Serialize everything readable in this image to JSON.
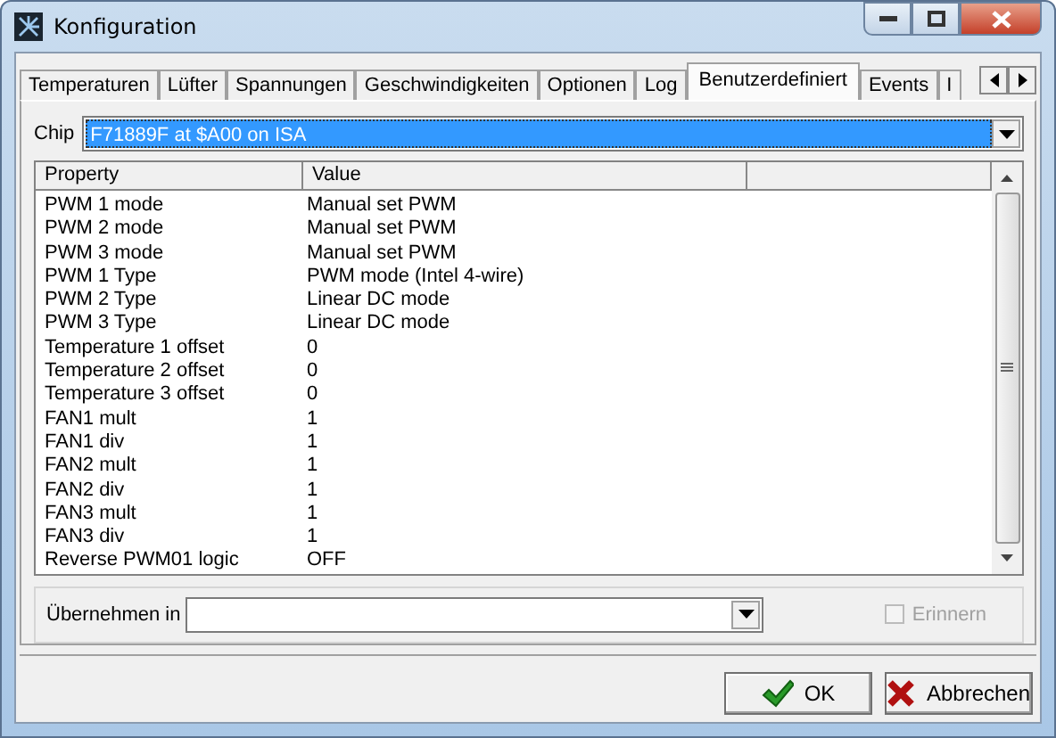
{
  "window": {
    "title": "Konfiguration"
  },
  "tabs": [
    {
      "label": "Temperaturen",
      "selected": false
    },
    {
      "label": "Lüfter",
      "selected": false
    },
    {
      "label": "Spannungen",
      "selected": false
    },
    {
      "label": "Geschwindigkeiten",
      "selected": false
    },
    {
      "label": "Optionen",
      "selected": false
    },
    {
      "label": "Log",
      "selected": false
    },
    {
      "label": "Benutzerdefiniert",
      "selected": true
    },
    {
      "label": "Events",
      "selected": false
    },
    {
      "label": "I",
      "selected": false
    }
  ],
  "chip": {
    "label": "Chip",
    "value": "F71889F at $A00 on ISA"
  },
  "table": {
    "columns": [
      "Property",
      "Value"
    ],
    "rows": [
      [
        "PWM 1 mode",
        "Manual set PWM"
      ],
      [
        "PWM 2 mode",
        "Manual set PWM"
      ],
      [
        "PWM 3 mode",
        "Manual set PWM"
      ],
      [
        "PWM 1 Type",
        "PWM mode (Intel 4-wire)"
      ],
      [
        "PWM 2 Type",
        "Linear DC mode"
      ],
      [
        "PWM 3 Type",
        "Linear DC mode"
      ],
      [
        "Temperature 1 offset",
        "0"
      ],
      [
        "Temperature 2 offset",
        "0"
      ],
      [
        "Temperature 3 offset",
        "0"
      ],
      [
        "FAN1 mult",
        "1"
      ],
      [
        "FAN1 div",
        "1"
      ],
      [
        "FAN2 mult",
        "1"
      ],
      [
        "FAN2 div",
        "1"
      ],
      [
        "FAN3 mult",
        "1"
      ],
      [
        "FAN3 div",
        "1"
      ],
      [
        "Reverse PWM01 logic",
        "OFF"
      ]
    ]
  },
  "apply": {
    "label": "Übernehmen in"
  },
  "remember": {
    "label": "Erinnern",
    "checked": false,
    "disabled": true
  },
  "buttons": [
    {
      "label": "OK",
      "kind": "ok"
    },
    {
      "label": "Abbrechen",
      "kind": "cancel"
    }
  ]
}
